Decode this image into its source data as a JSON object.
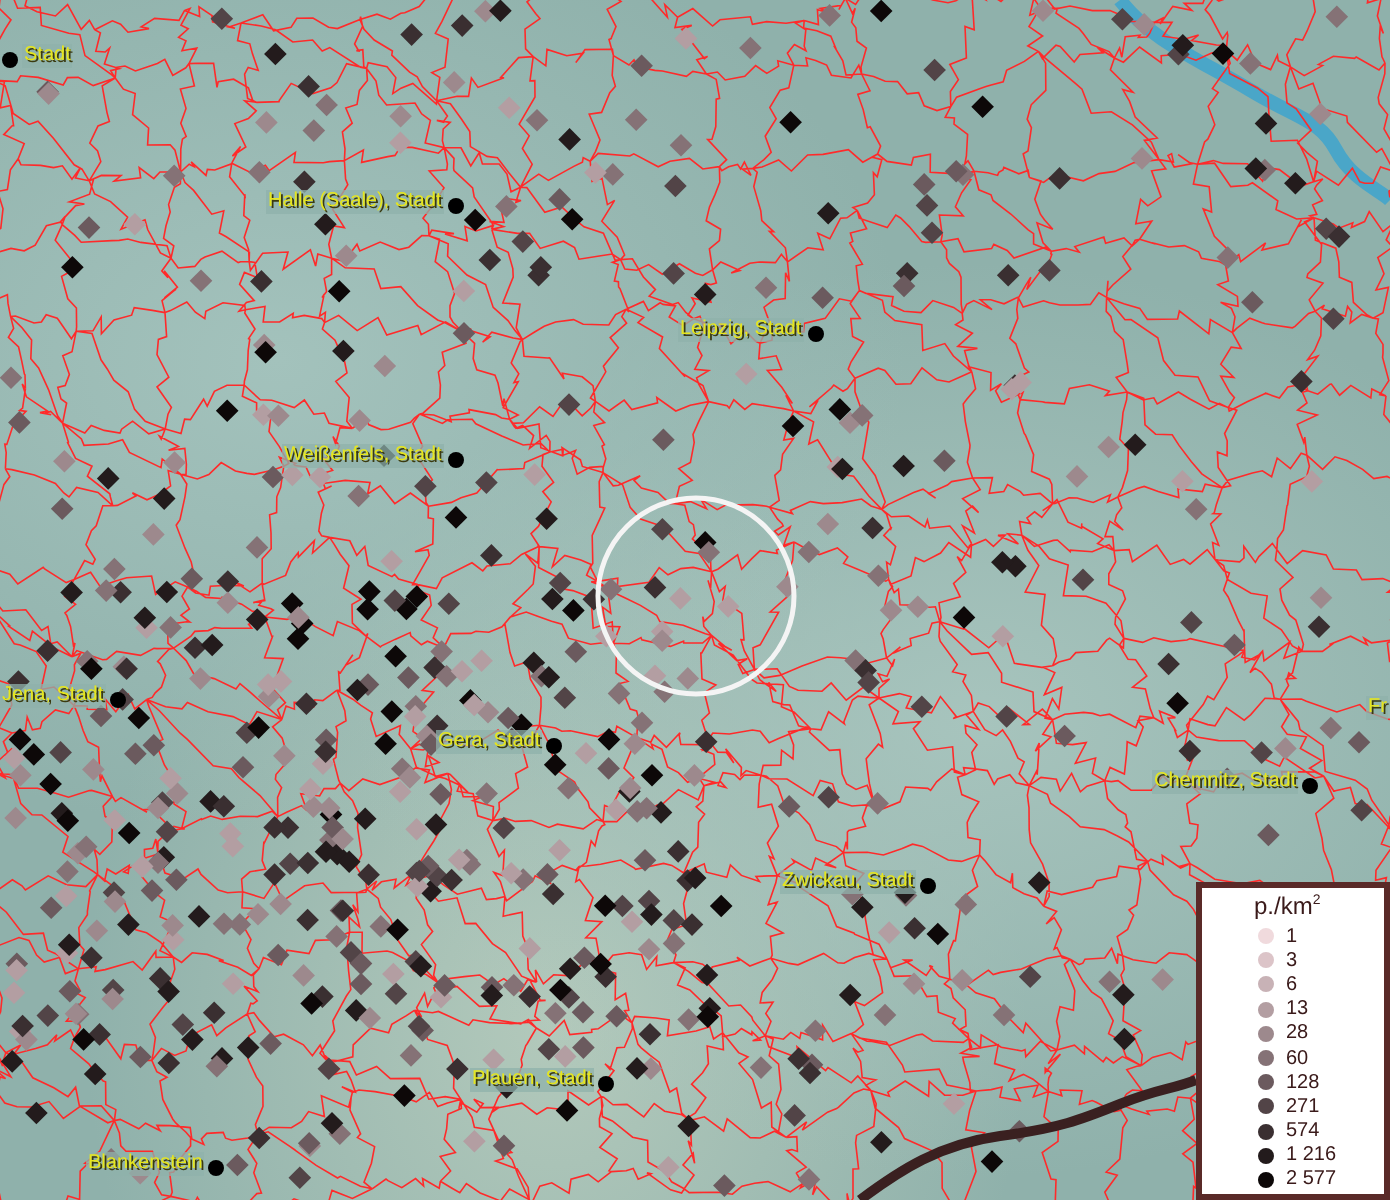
{
  "map": {
    "place_labels": [
      {
        "text": "Stadt"
      },
      {
        "text": "Halle (Saale), Stadt"
      },
      {
        "text": "Leipzig, Stadt"
      },
      {
        "text": "Weißenfels, Stadt"
      },
      {
        "text": "Jena, Stadt"
      },
      {
        "text": "Gera, Stadt"
      },
      {
        "text": "Chemnitz, Stadt"
      },
      {
        "text": "Zwickau, Stadt"
      },
      {
        "text": "Plauen, Stadt"
      },
      {
        "text": "Blankenstein"
      },
      {
        "text": "Fr"
      }
    ]
  },
  "legend": {
    "title": "p./km$^{2}$",
    "items": [
      {
        "label": "1",
        "color": "#f0dadd"
      },
      {
        "label": "3",
        "color": "#dcc4c8"
      },
      {
        "label": "6",
        "color": "#c8b2b6"
      },
      {
        "label": "13",
        "color": "#b39ea2"
      },
      {
        "label": "28",
        "color": "#9d898d"
      },
      {
        "label": "60",
        "color": "#857276"
      },
      {
        "label": "128",
        "color": "#6b5a5e"
      },
      {
        "label": "271",
        "color": "#524447"
      },
      {
        "label": "574",
        "color": "#3a2f31"
      },
      {
        "label": "1 216",
        "color": "#231b1c"
      },
      {
        "label": "2 577",
        "color": "#0d0808"
      }
    ]
  }
}
